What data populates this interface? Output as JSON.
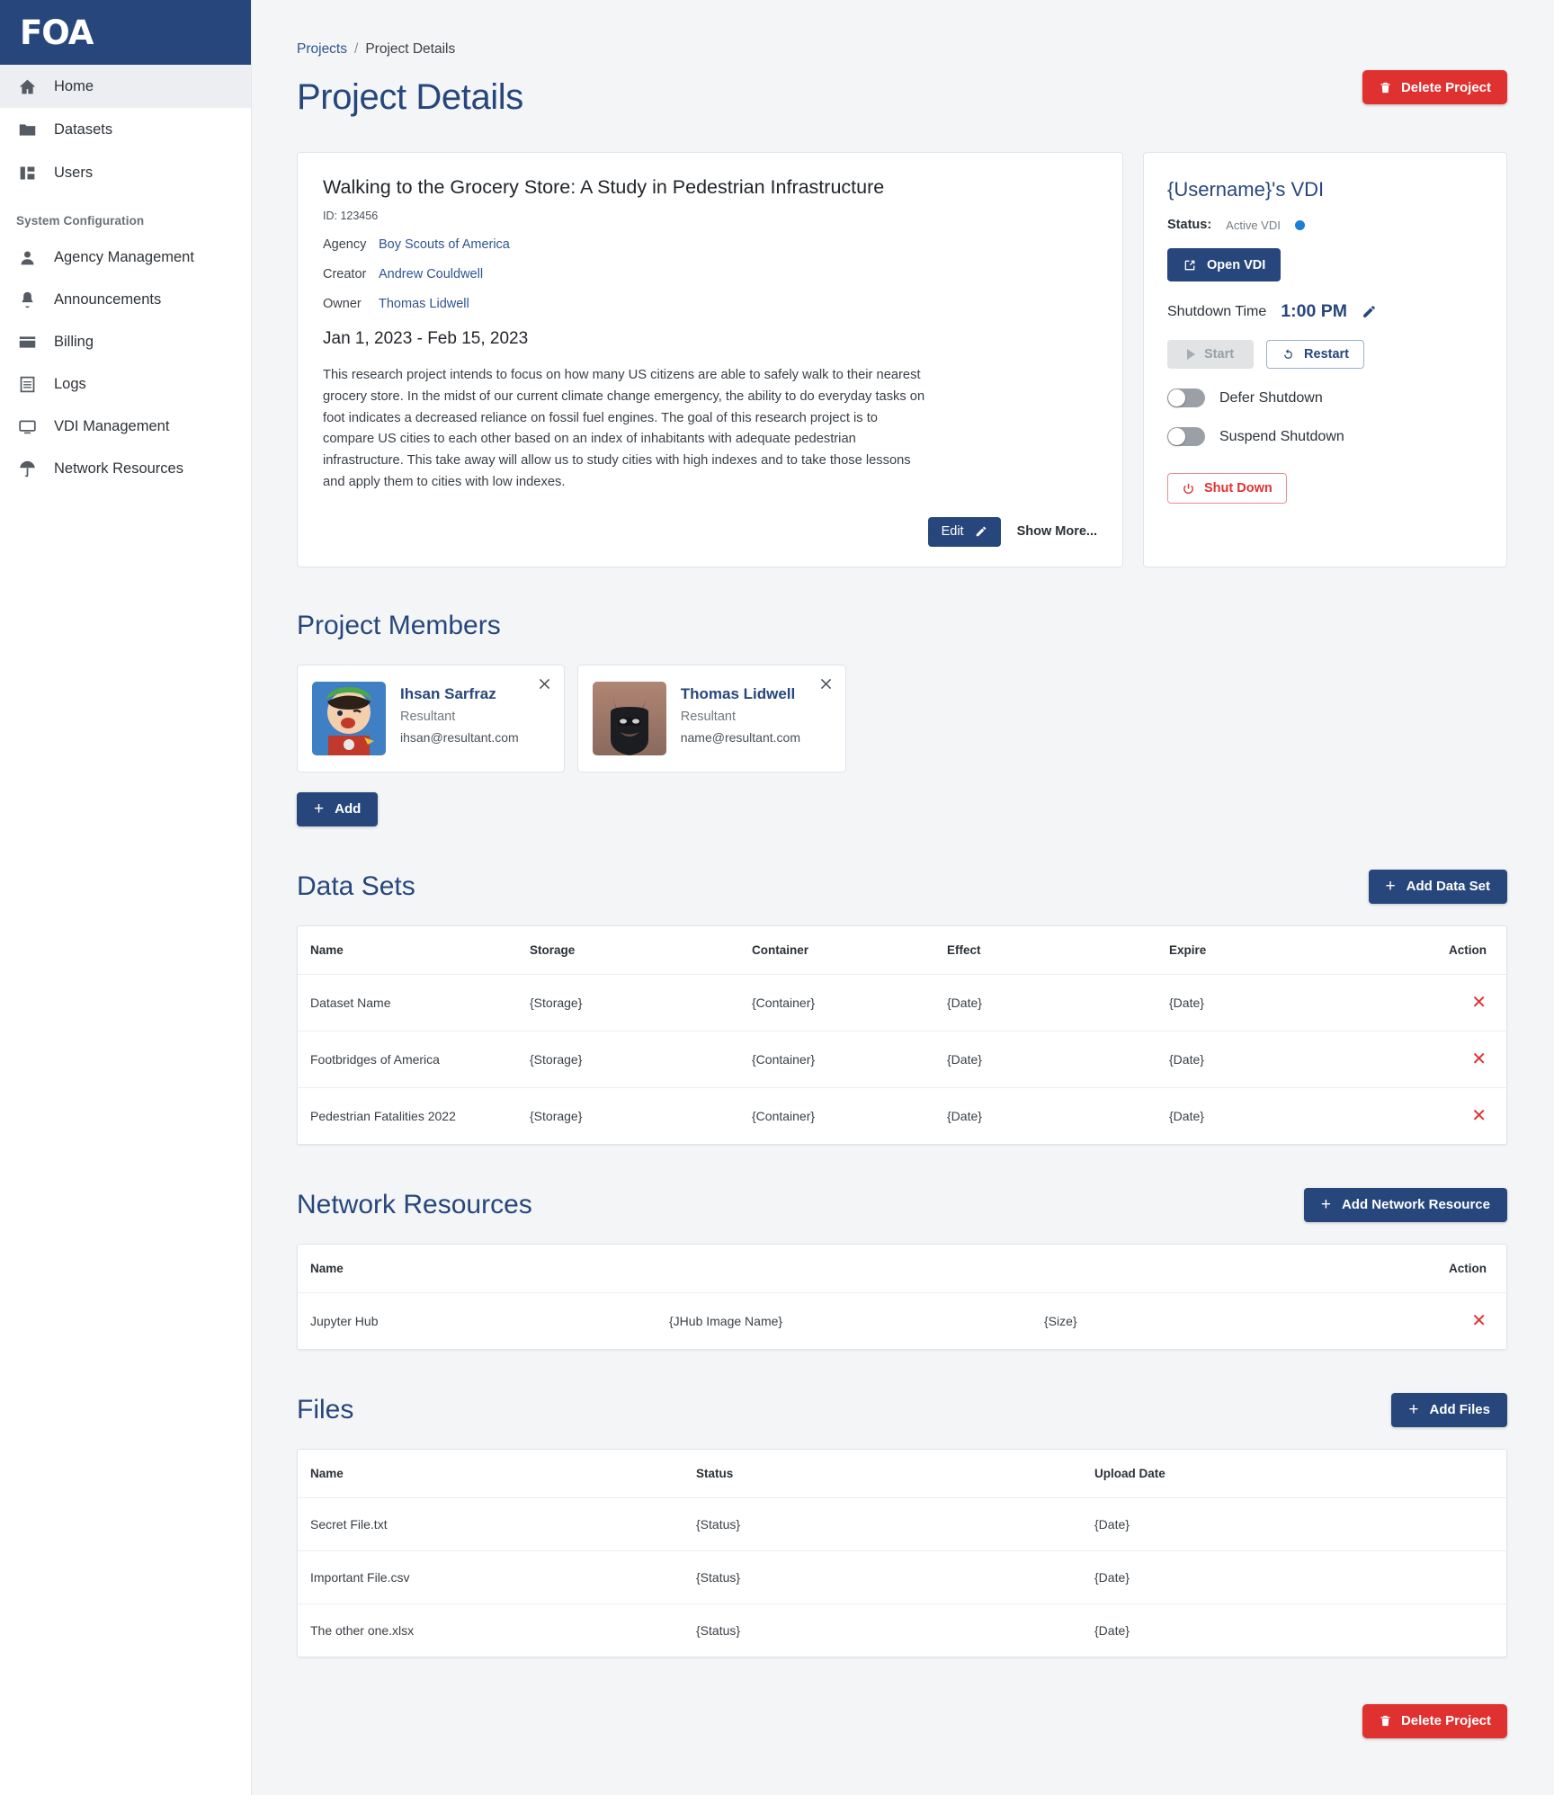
{
  "brand": {
    "logo_text": "FOA"
  },
  "sidebar": {
    "items": [
      {
        "label": "Home",
        "icon": "home-icon",
        "active": true
      },
      {
        "label": "Datasets",
        "icon": "folder-icon",
        "active": false
      },
      {
        "label": "Users",
        "icon": "users-grid-icon",
        "active": false
      }
    ],
    "section_label": "System Configuration",
    "config_items": [
      {
        "label": "Agency Management",
        "icon": "person-icon"
      },
      {
        "label": "Announcements",
        "icon": "bell-icon"
      },
      {
        "label": "Billing",
        "icon": "credit-card-icon"
      },
      {
        "label": "Logs",
        "icon": "list-log-icon"
      },
      {
        "label": "VDI Management",
        "icon": "monitor-icon"
      },
      {
        "label": "Network Resources",
        "icon": "umbrella-icon"
      }
    ]
  },
  "breadcrumb": {
    "parent": "Projects",
    "separator": "/",
    "current": "Project Details"
  },
  "page": {
    "title": "Project Details"
  },
  "delete_button": {
    "label": "Delete Project"
  },
  "project": {
    "title": "Walking to the Grocery Store: A Study in Pedestrian Infrastructure",
    "id_label": "ID: 123456",
    "agency_key": "Agency",
    "agency_value": "Boy Scouts of America",
    "creator_key": "Creator",
    "creator_value": "Andrew Couldwell",
    "owner_key": "Owner",
    "owner_value": "Thomas Lidwell",
    "dates": "Jan 1, 2023 - Feb 15, 2023",
    "description": "This research project intends to focus on how many US citizens are able to safely walk to their nearest grocery store.  In the midst of our current climate change emergency, the ability to do everyday tasks on foot indicates a decreased reliance on fossil fuel engines.  The goal of this research project is to compare US cities to each other based on an index of inhabitants with adequate pedestrian infrastructure. This take away will allow us to study cities with high indexes and to take those lessons and apply them to cities with low indexes.",
    "edit_label": "Edit",
    "show_more_label": "Show More..."
  },
  "vdi": {
    "title": "{Username}'s VDI",
    "status_key": "Status:",
    "status_value": "Active VDI",
    "status_color": "#1b7fd4",
    "open_label": "Open VDI",
    "shutdown_time_key": "Shutdown Time",
    "shutdown_time_value": "1:00 PM",
    "start_label": "Start",
    "restart_label": "Restart",
    "defer_label": "Defer Shutdown",
    "suspend_label": "Suspend Shutdown",
    "shutdown_label": "Shut Down"
  },
  "members": {
    "title": "Project Members",
    "add_label": "Add",
    "list": [
      {
        "name": "Ihsan Sarfraz",
        "role": "Resultant",
        "email": "ihsan@resultant.com",
        "avatar": "toy-figure-photo"
      },
      {
        "name": "Thomas Lidwell",
        "role": "Resultant",
        "email": "name@resultant.com",
        "avatar": "batman-photo"
      }
    ]
  },
  "datasets": {
    "title": "Data Sets",
    "add_label": "Add Data Set",
    "columns": [
      "Name",
      "Storage",
      "Container",
      "Effect",
      "Expire",
      "Action"
    ],
    "rows": [
      {
        "name": "Dataset Name",
        "storage": "{Storage}",
        "container": "{Container}",
        "effect": "{Date}",
        "expire": "{Date}"
      },
      {
        "name": "Footbridges of America",
        "storage": "{Storage}",
        "container": "{Container}",
        "effect": "{Date}",
        "expire": "{Date}"
      },
      {
        "name": "Pedestrian Fatalities 2022",
        "storage": "{Storage}",
        "container": "{Container}",
        "effect": "{Date}",
        "expire": "{Date}"
      }
    ]
  },
  "network": {
    "title": "Network Resources",
    "add_label": "Add Network Resource",
    "columns": [
      "Name",
      "Action"
    ],
    "rows": [
      {
        "name": "Jupyter Hub",
        "image": "{JHub Image Name}",
        "size": "{Size}"
      }
    ]
  },
  "files": {
    "title": "Files",
    "add_label": "Add Files",
    "columns": [
      "Name",
      "Status",
      "Upload Date"
    ],
    "rows": [
      {
        "name": "Secret File.txt",
        "status": "{Status}",
        "date": "{Date}"
      },
      {
        "name": "Important File.csv",
        "status": "{Status}",
        "date": "{Date}"
      },
      {
        "name": "The other one.xlsx",
        "status": "{Status}",
        "date": "{Date}"
      }
    ]
  },
  "bottom_delete": {
    "label": "Delete Project"
  }
}
